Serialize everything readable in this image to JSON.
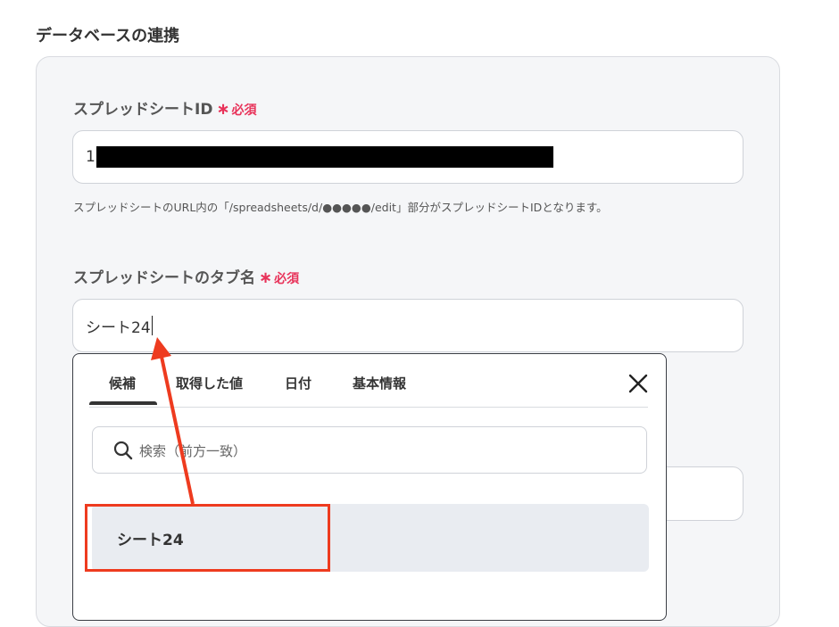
{
  "section": {
    "title": "データベースの連携"
  },
  "spreadsheet_id": {
    "label": "スプレッドシートID",
    "required_label": "必須",
    "value_prefix": "1",
    "help": "スプレッドシートのURL内の「/spreadsheets/d/●●●●●/edit」部分がスプレッドシートIDとなります。"
  },
  "tab_name": {
    "label": "スプレッドシートのタブ名",
    "required_label": "必須",
    "value": "シート24"
  },
  "dropdown": {
    "tabs": [
      {
        "label": "候補",
        "active": true
      },
      {
        "label": "取得した値"
      },
      {
        "label": "日付"
      },
      {
        "label": "基本情報"
      }
    ],
    "search_placeholder": "検索（前方一致）",
    "options": [
      {
        "label": "シート24"
      }
    ]
  },
  "colors": {
    "required": "#e8335a",
    "annotation": "#ee3b1f",
    "panel_bg": "#f5f6f8",
    "option_bg": "#e9ecf1"
  },
  "icons": [
    "asterisk-icon",
    "close-icon",
    "search-icon",
    "annotation-arrow"
  ]
}
